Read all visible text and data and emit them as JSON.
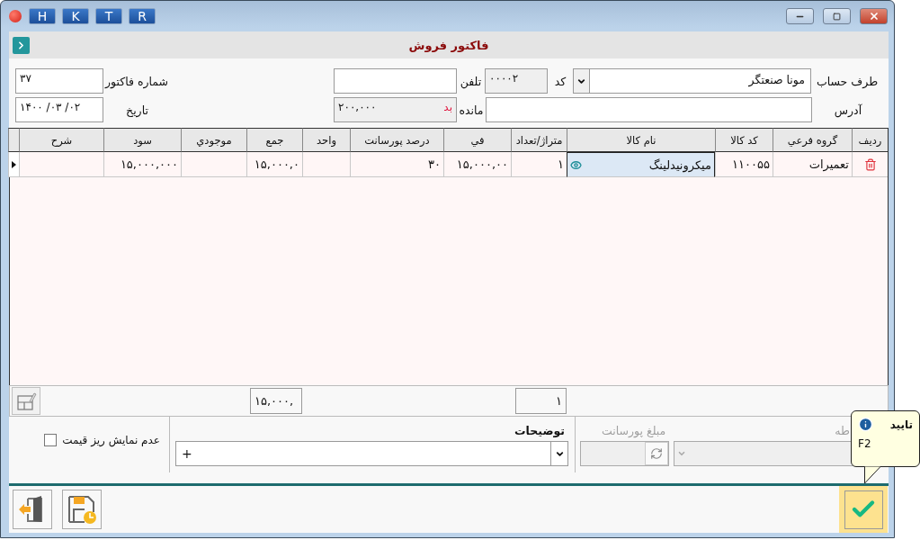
{
  "window": {
    "toolbar_buttons": [
      "R",
      "T",
      "K",
      "H"
    ]
  },
  "header": {
    "title": "فاکتور فروش"
  },
  "form": {
    "account": {
      "label": "طرف حساب",
      "value": "مونا صنعتگر"
    },
    "code": {
      "label": "کد",
      "value": "۰۰۰۰۲"
    },
    "phone": {
      "label": "تلفن"
    },
    "invoice_number": {
      "label": "شماره فاکتور",
      "value": "۳۷"
    },
    "address": {
      "label": "آدرس"
    },
    "balance": {
      "label": "مانده",
      "status": "بد",
      "value": "۲۰۰,۰۰۰"
    },
    "date": {
      "label": "تاریخ",
      "value": "۱۴۰۰ /۰۳ /۰۲"
    }
  },
  "table": {
    "columns": [
      "ردیف",
      "گروه فرعي",
      "کد کالا",
      "نام کالا",
      "متراژ/تعداد",
      "في",
      "درصد پورسانت",
      "واحد",
      "جمع",
      "موجودي",
      "سود",
      "شرح"
    ],
    "rows": [
      {
        "current": true,
        "name_focused": true,
        "group": "تعمیرات",
        "code": "۱۱۰۰۵۵",
        "name": "میکرونیدلینگ",
        "quantity": "۱",
        "price": "۱۵,۰۰۰,۰۰",
        "commission_percent": "۳۰",
        "total": "۱۵,۰۰۰,۰",
        "profit": "۱۵,۰۰۰,۰۰۰"
      }
    ]
  },
  "totals": {
    "quantity": "۱",
    "total": "۱۵,۰۰۰,"
  },
  "bottom": {
    "hide_price_details": {
      "label": "عدم نمایش ریز قیمت",
      "checked": false
    },
    "notes": {
      "label": "توضیحات",
      "value": "+"
    },
    "commission_amount": {
      "label": "مبلغ پورسانت",
      "disabled": true
    },
    "region": {
      "label": "طه",
      "disabled": true
    }
  },
  "tooltip": {
    "title": "تایید",
    "text": "F2"
  }
}
